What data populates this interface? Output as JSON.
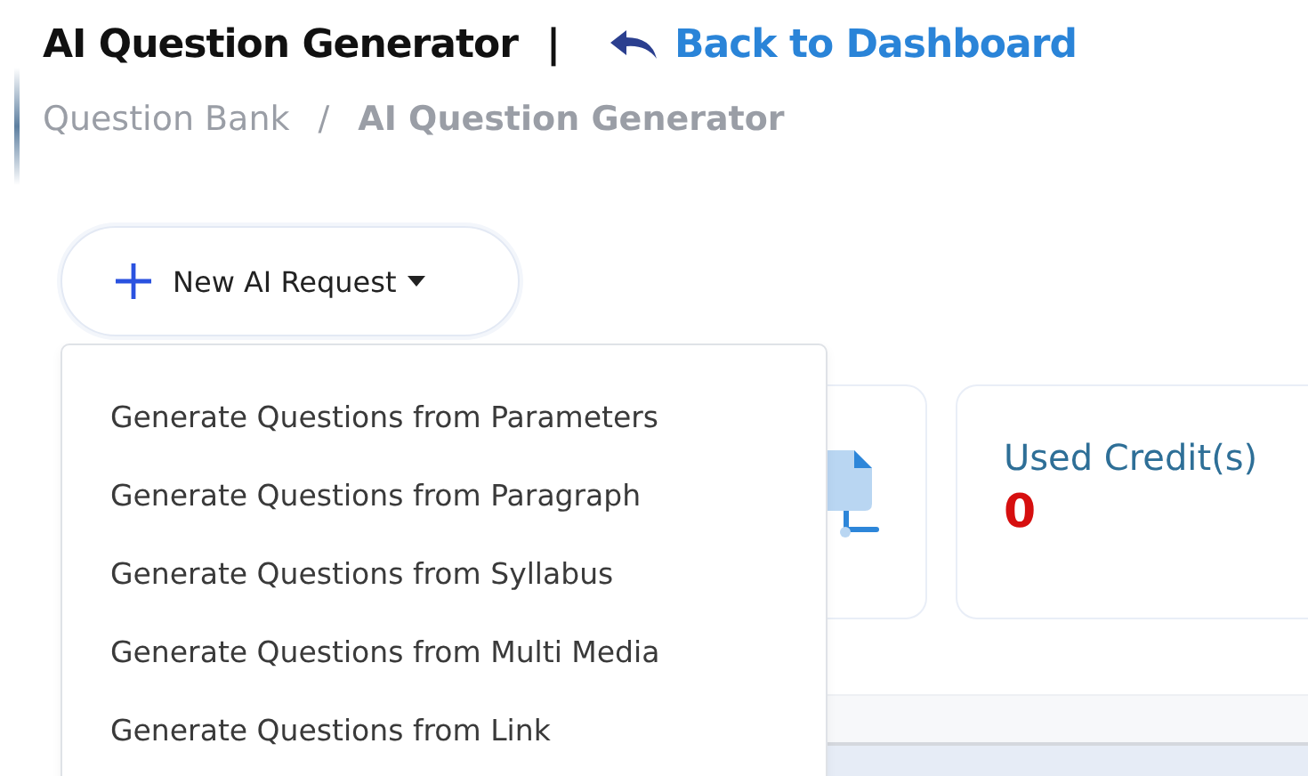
{
  "header": {
    "title": "AI Question Generator",
    "separator": "|",
    "back_link": "Back to Dashboard"
  },
  "breadcrumb": {
    "separator": "/",
    "items": [
      "Question Bank",
      "AI Question Generator"
    ]
  },
  "new_request_button": {
    "label": "New AI Request",
    "expanded": true
  },
  "dropdown_menu": [
    {
      "label": "Generate Questions from Parameters"
    },
    {
      "label": "Generate Questions from Paragraph"
    },
    {
      "label": "Generate Questions from Syllabus"
    },
    {
      "label": "Generate Questions from Multi Media"
    },
    {
      "label": "Generate Questions from Link"
    }
  ],
  "stat_cards": [
    {
      "kind": "icon"
    },
    {
      "kind": "text",
      "label": "Used Credit(s)",
      "value": "0"
    }
  ]
}
